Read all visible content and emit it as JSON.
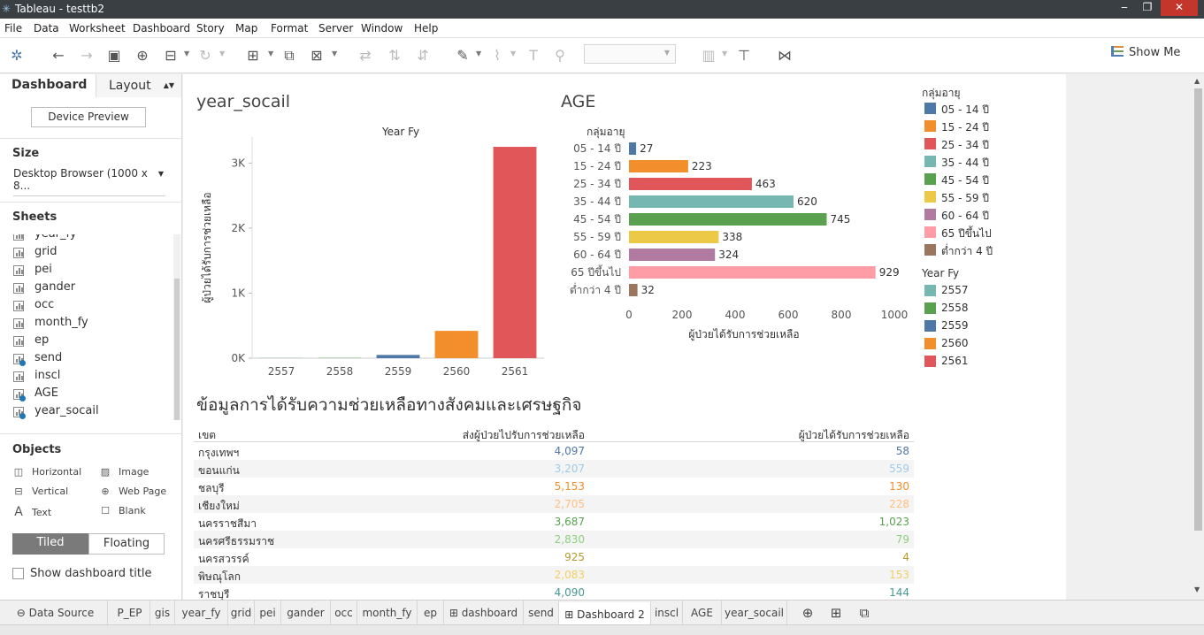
{
  "window": {
    "title": "Tableau - testtb2"
  },
  "menu": [
    "File",
    "Data",
    "Worksheet",
    "Dashboard",
    "Story",
    "Map",
    "Format",
    "Server",
    "Window",
    "Help"
  ],
  "toolbar": {
    "show_me": "Show Me"
  },
  "sidebar": {
    "tabs": {
      "dashboard": "Dashboard",
      "layout": "Layout"
    },
    "device_preview": "Device Preview",
    "size_label": "Size",
    "size_value": "Desktop Browser (1000 x 8...",
    "sheets_label": "Sheets",
    "sheets": [
      {
        "name": "year_fy",
        "used": false
      },
      {
        "name": "grid",
        "used": false
      },
      {
        "name": "pei",
        "used": false
      },
      {
        "name": "gander",
        "used": false
      },
      {
        "name": "occ",
        "used": false
      },
      {
        "name": "month_fy",
        "used": false
      },
      {
        "name": "ep",
        "used": false
      },
      {
        "name": "send",
        "used": true
      },
      {
        "name": "inscl",
        "used": false
      },
      {
        "name": "AGE",
        "used": true
      },
      {
        "name": "year_socail",
        "used": true
      }
    ],
    "objects_label": "Objects",
    "objects": [
      {
        "label": "Horizontal",
        "icon": "horizontal-icon"
      },
      {
        "label": "Image",
        "icon": "image-icon"
      },
      {
        "label": "Vertical",
        "icon": "vertical-icon"
      },
      {
        "label": "Web Page",
        "icon": "globe-icon"
      },
      {
        "label": "Text",
        "icon": "text-icon"
      },
      {
        "label": "Blank",
        "icon": "blank-icon"
      }
    ],
    "tiled": "Tiled",
    "floating": "Floating",
    "show_title": "Show dashboard title"
  },
  "dashboard": {
    "year_chart": {
      "sheet_title": "year_socail"
    },
    "age_chart": {
      "sheet_title": "AGE",
      "header": "กลุ่มอายุ"
    },
    "age_legend": {
      "title": "กลุ่มอายุ"
    },
    "year_legend": {
      "title": "Year Fy"
    },
    "table": {
      "title": "ข้อมูลการได้รับความช่วยเหลือทางสังคมและเศรษฐกิจ",
      "headers": [
        "เขต",
        "ส่งผู้ป่วยไปรับการช่วยเหลือ",
        "ผู้ป่วยได้รับการช่วยเหลือ"
      ],
      "rows": [
        {
          "zone": "กรุงเทพฯ",
          "sent": "4,097",
          "received": "58",
          "color": "#4e79a7"
        },
        {
          "zone": "ขอนแก่น",
          "sent": "3,207",
          "received": "559",
          "color": "#a0cbe8"
        },
        {
          "zone": "ชลบุรี",
          "sent": "5,153",
          "received": "130",
          "color": "#f28e2b"
        },
        {
          "zone": "เชียงใหม่",
          "sent": "2,705",
          "received": "228",
          "color": "#ffbe7d"
        },
        {
          "zone": "นครราชสีมา",
          "sent": "3,687",
          "received": "1,023",
          "color": "#59a14f"
        },
        {
          "zone": "นครศรีธรรมราช",
          "sent": "2,830",
          "received": "79",
          "color": "#8cd17d"
        },
        {
          "zone": "นครสวรรค์",
          "sent": "925",
          "received": "4",
          "color": "#b6992d"
        },
        {
          "zone": "พิษณุโลก",
          "sent": "2,083",
          "received": "153",
          "color": "#f1ce63"
        },
        {
          "zone": "ราชบุรี",
          "sent": "4,090",
          "received": "144",
          "color": "#499894"
        }
      ]
    }
  },
  "chart_data": [
    {
      "type": "bar",
      "title": "Year Fy",
      "ylabel": "ผู้ป่วยได้รับการช่วยเหลือ",
      "categories": [
        "2557",
        "2558",
        "2559",
        "2560",
        "2561"
      ],
      "values": [
        4,
        5,
        50,
        420,
        3250
      ],
      "colors": [
        "#76b7b2",
        "#59a14f",
        "#4e79a7",
        "#f28e2b",
        "#e15759"
      ],
      "yticks": [
        "0K",
        "1K",
        "2K",
        "3K"
      ],
      "ylim": [
        0,
        3400
      ]
    },
    {
      "type": "bar",
      "orientation": "horizontal",
      "xlabel": "ผู้ป่วยได้รับการช่วยเหลือ",
      "categories": [
        "05 - 14 ปี",
        "15 - 24 ปี",
        "25 - 34 ปี",
        "35 - 44 ปี",
        "45 - 54 ปี",
        "55 - 59 ปี",
        "60 - 64 ปี",
        "65 ปีขึ้นไป",
        "ต่ำกว่า 4 ปี"
      ],
      "values": [
        27,
        223,
        463,
        620,
        745,
        338,
        324,
        929,
        32
      ],
      "value_labels": [
        "27",
        "223",
        "463",
        "620",
        "745",
        "338",
        "324",
        "929",
        "32"
      ],
      "colors": [
        "#4e79a7",
        "#f28e2b",
        "#e15759",
        "#76b7b2",
        "#59a14f",
        "#edc948",
        "#b07aa1",
        "#ff9da7",
        "#9c755f"
      ],
      "xticks": [
        "0",
        "200",
        "400",
        "600",
        "800",
        "1000"
      ],
      "xlim": [
        0,
        1000
      ]
    }
  ],
  "legends": {
    "age": [
      {
        "label": "05 - 14 ปี",
        "color": "#4e79a7"
      },
      {
        "label": "15 - 24 ปี",
        "color": "#f28e2b"
      },
      {
        "label": "25 - 34 ปี",
        "color": "#e15759"
      },
      {
        "label": "35 - 44 ปี",
        "color": "#76b7b2"
      },
      {
        "label": "45 - 54 ปี",
        "color": "#59a14f"
      },
      {
        "label": "55 - 59 ปี",
        "color": "#edc948"
      },
      {
        "label": "60 - 64 ปี",
        "color": "#b07aa1"
      },
      {
        "label": "65 ปีขึ้นไป",
        "color": "#ff9da7"
      },
      {
        "label": "ต่ำกว่า 4 ปี",
        "color": "#9c755f"
      }
    ],
    "year": [
      {
        "label": "2557",
        "color": "#76b7b2"
      },
      {
        "label": "2558",
        "color": "#59a14f"
      },
      {
        "label": "2559",
        "color": "#4e79a7"
      },
      {
        "label": "2560",
        "color": "#f28e2b"
      },
      {
        "label": "2561",
        "color": "#e15759"
      }
    ]
  },
  "bottom_tabs": [
    "Data Source",
    "P_EP",
    "gis",
    "year_fy",
    "grid",
    "pei",
    "gander",
    "occ",
    "month_fy",
    "ep",
    "dashboard",
    "send",
    "Dashboard 2",
    "inscl",
    "AGE",
    "year_socail"
  ],
  "active_tab": "Dashboard 2"
}
